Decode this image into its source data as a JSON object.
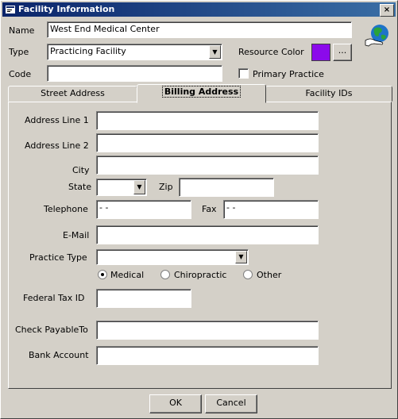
{
  "window": {
    "title": "Facility Information",
    "close_glyph": "×"
  },
  "header": {
    "name_label": "Name",
    "name_value": "West End Medical Center",
    "type_label": "Type",
    "type_value": "Practicing Facility",
    "code_label": "Code",
    "code_value": "",
    "resource_color_label": "Resource Color",
    "resource_color": "#8b0aeb",
    "ellipsis_label": "...",
    "primary_practice_label": "Primary Practice",
    "primary_practice_checked": false
  },
  "tabs": [
    {
      "label": "Street Address"
    },
    {
      "label": "Billing Address",
      "active": true
    },
    {
      "label": "Facility IDs"
    }
  ],
  "billing": {
    "address1_label": "Address Line 1",
    "address1_value": "",
    "address2_label": "Address Line 2",
    "address2_value": "",
    "city_label": "City",
    "city_value": "",
    "state_label": "State",
    "state_value": "",
    "zip_label": "Zip",
    "zip_value": "",
    "telephone_label": "Telephone",
    "telephone_value": "    -    -",
    "fax_label": "Fax",
    "fax_value": "    -    -",
    "email_label": "E-Mail",
    "email_value": "",
    "practice_type_label": "Practice Type",
    "practice_type_value": "",
    "radio_medical": "Medical",
    "radio_chiropractic": "Chiropractic",
    "radio_other": "Other",
    "selected_radio": "Medical",
    "federal_tax_label": "Federal Tax ID",
    "federal_tax_value": "",
    "check_payable_label": "Check PayableTo",
    "check_payable_value": "",
    "bank_account_label": "Bank Account",
    "bank_account_value": ""
  },
  "footer": {
    "ok_label": "OK",
    "cancel_label": "Cancel"
  }
}
